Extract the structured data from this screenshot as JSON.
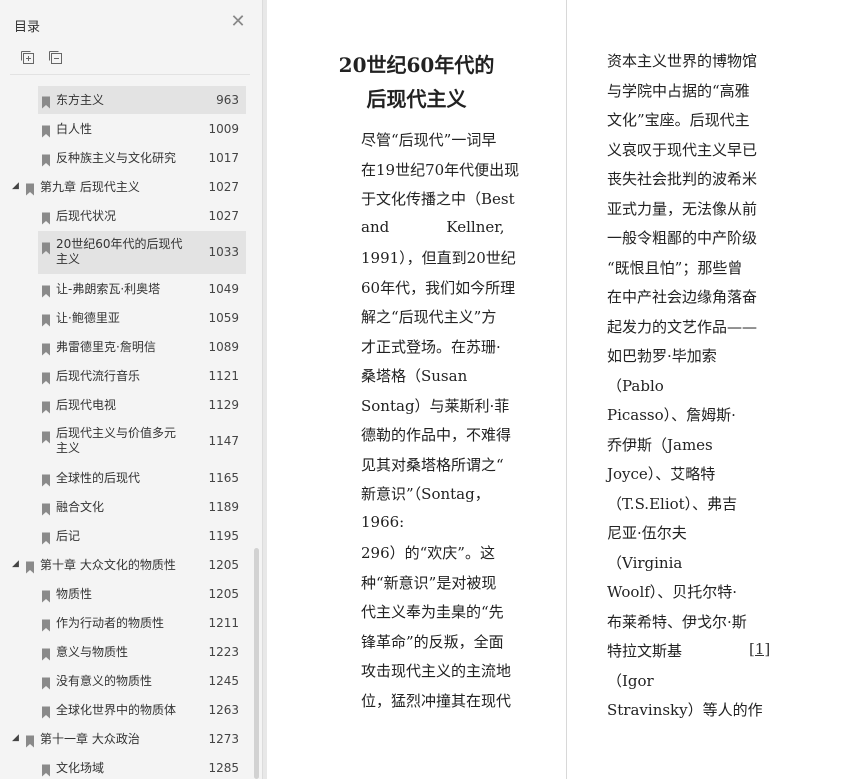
{
  "toc": {
    "title": "目录",
    "close_icon": "close-icon",
    "expand_icon": "expand-all-icon",
    "collapse_icon": "collapse-all-icon",
    "items": [
      {
        "label": "东方主义",
        "page": "963",
        "level": 2,
        "highlight": true
      },
      {
        "label": "白人性",
        "page": "1009",
        "level": 2
      },
      {
        "label": "反种族主义与文化研究",
        "page": "1017",
        "level": 2
      },
      {
        "label": "第九章 后现代主义",
        "page": "1027",
        "level": 1,
        "expanded": true
      },
      {
        "label": "后现代状况",
        "page": "1027",
        "level": 2
      },
      {
        "label": "20世纪60年代的后现代主义",
        "page": "1033",
        "level": 2,
        "selected": true,
        "wrap": [
          "20世纪60年代的后现代",
          "主义"
        ]
      },
      {
        "label": "让-弗朗索瓦·利奥塔",
        "page": "1049",
        "level": 2
      },
      {
        "label": "让·鲍德里亚",
        "page": "1059",
        "level": 2
      },
      {
        "label": "弗雷德里克·詹明信",
        "page": "1089",
        "level": 2
      },
      {
        "label": "后现代流行音乐",
        "page": "1121",
        "level": 2
      },
      {
        "label": "后现代电视",
        "page": "1129",
        "level": 2
      },
      {
        "label": "后现代主义与价值多元主义",
        "page": "1147",
        "level": 2,
        "wrap": [
          "后现代主义与价值多元",
          "主义"
        ]
      },
      {
        "label": "全球性的后现代",
        "page": "1165",
        "level": 2
      },
      {
        "label": "融合文化",
        "page": "1189",
        "level": 2
      },
      {
        "label": "后记",
        "page": "1195",
        "level": 2
      },
      {
        "label": "第十章 大众文化的物质性",
        "page": "1205",
        "level": 1,
        "expanded": true
      },
      {
        "label": "物质性",
        "page": "1205",
        "level": 2
      },
      {
        "label": "作为行动者的物质性",
        "page": "1211",
        "level": 2
      },
      {
        "label": "意义与物质性",
        "page": "1223",
        "level": 2
      },
      {
        "label": "没有意义的物质性",
        "page": "1245",
        "level": 2
      },
      {
        "label": "全球化世界中的物质体",
        "page": "1263",
        "level": 2
      },
      {
        "label": "第十一章 大众政治",
        "page": "1273",
        "level": 1,
        "expanded": true
      },
      {
        "label": "文化场域",
        "page": "1285",
        "level": 2
      }
    ]
  },
  "book": {
    "heading": [
      "20世纪60年代的",
      "后现代主义"
    ],
    "left_lines": [
      "尽管“后现代”一词早",
      "在19世纪70年代便出现",
      "于文化传播之中（Best",
      "and            Kellner,",
      "1991），但直到20世纪",
      "60年代，我们如今所理",
      "解之“后现代主义”方",
      "才正式登场。在苏珊·",
      "桑塔格（Susan",
      "Sontag）与莱斯利·菲",
      "德勒的作品中，不难得",
      "见其对桑塔格所谓之“",
      "新意识”（Sontag，",
      "1966:",
      "296）的“欢庆”。这",
      "种“新意识”是对被现",
      "代主义奉为圭臬的“先",
      "锋革命”的反叛，全面",
      "攻击现代主义的主流地",
      "位，猛烈冲撞其在现代"
    ],
    "right_lines": [
      "资本主义世界的博物馆",
      "与学院中占据的“高雅",
      "文化”宝座。后现代主",
      "义哀叹于现代主义早已",
      "丧失社会批判的波希米",
      "亚式力量，无法像从前",
      "一般令粗鄙的中产阶级",
      "“既恨且怕”；那些曾",
      "在中产社会边缘角落奋",
      "起发力的文艺作品——",
      "如巴勃罗·毕加索",
      "（Pablo",
      "Picasso）、詹姆斯·",
      "乔伊斯（James",
      "Joyce）、艾略特",
      "（T.S.Eliot）、弗吉",
      "尼亚·伍尔夫",
      "（Virginia",
      "Woolf）、贝托尔特·",
      "布莱希特、伊戈尔·斯",
      "特拉文斯基",
      "（Igor",
      "Stravinsky）等人的作"
    ],
    "footnote": "[1]"
  }
}
